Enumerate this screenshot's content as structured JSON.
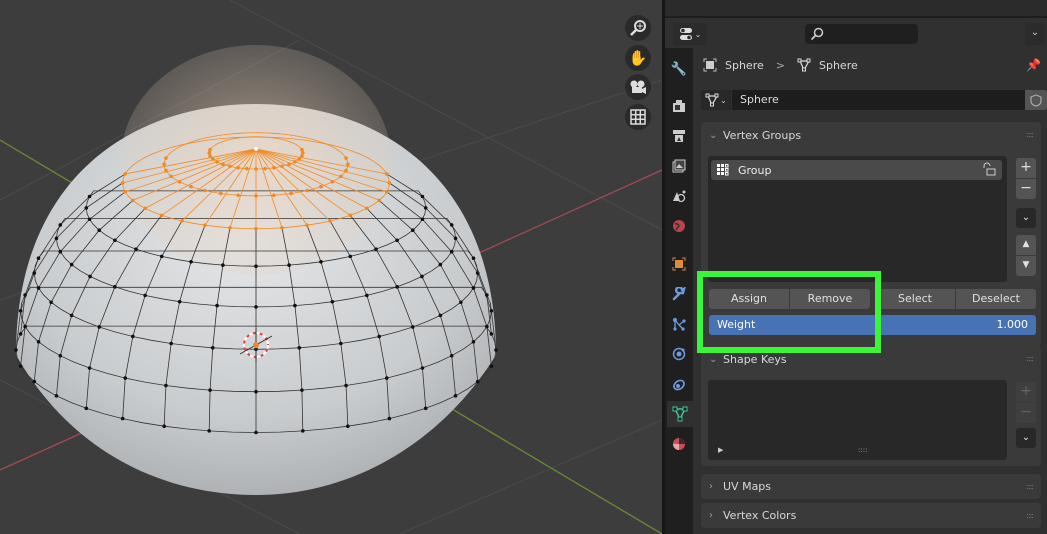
{
  "viewport": {
    "nav_gizmos": [
      {
        "name": "zoom-icon"
      },
      {
        "name": "hand-pan-icon"
      },
      {
        "name": "camera-icon"
      },
      {
        "name": "grid-perspective-icon"
      }
    ],
    "selection_color": "#f08a24"
  },
  "properties": {
    "header": {
      "editor_type_icon": "properties-editor-icon",
      "search_placeholder": ""
    },
    "breadcrumb": {
      "object": "Sphere",
      "separator": ">",
      "mesh": "Sphere"
    },
    "datablock": {
      "name": "Sphere"
    },
    "tabs": [
      {
        "name": "tool",
        "icon": "tool-icon"
      },
      {
        "name": "render",
        "icon": "render-icon"
      },
      {
        "name": "output",
        "icon": "output-icon"
      },
      {
        "name": "view-layer",
        "icon": "view-layer-icon"
      },
      {
        "name": "scene",
        "icon": "scene-icon"
      },
      {
        "name": "world",
        "icon": "world-icon"
      },
      {
        "name": "object",
        "icon": "object-icon"
      },
      {
        "name": "modifiers",
        "icon": "wrench-icon"
      },
      {
        "name": "particles",
        "icon": "particles-icon"
      },
      {
        "name": "physics",
        "icon": "physics-icon"
      },
      {
        "name": "constraints",
        "icon": "constraints-icon"
      },
      {
        "name": "data",
        "icon": "mesh-data-icon",
        "active": true
      },
      {
        "name": "material",
        "icon": "material-icon"
      }
    ],
    "vertex_groups": {
      "title": "Vertex Groups",
      "items": [
        {
          "name": "Group"
        }
      ],
      "assign_label": "Assign",
      "remove_label": "Remove",
      "select_label": "Select",
      "deselect_label": "Deselect",
      "weight_label": "Weight",
      "weight_value": "1.000"
    },
    "shape_keys": {
      "title": "Shape Keys"
    },
    "uv_maps": {
      "title": "UV Maps"
    },
    "vertex_colors": {
      "title": "Vertex Colors"
    }
  },
  "highlight_color": "#3cf53a"
}
